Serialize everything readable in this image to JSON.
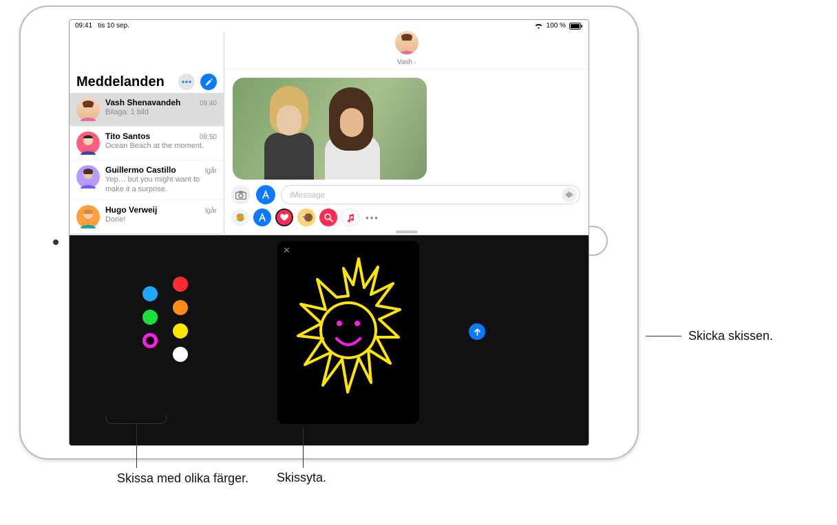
{
  "status": {
    "time": "09:41",
    "date": "tis 10 sep.",
    "battery_pct": "100 %"
  },
  "sidebar": {
    "title": "Meddelanden",
    "items": [
      {
        "name": "Vash Shenavandeh",
        "time": "09:40",
        "preview": "Bilaga: 1 bild"
      },
      {
        "name": "Tito Santos",
        "time": "08:50",
        "preview": "Ocean Beach at the moment."
      },
      {
        "name": "Guillermo Castillo",
        "time": "Igår",
        "preview": "Yep… but you might want to make it a surprise."
      },
      {
        "name": "Hugo Verweij",
        "time": "Igår",
        "preview": "Done!"
      }
    ]
  },
  "conversation": {
    "contact_name": "Vash",
    "input_placeholder": "iMessage"
  },
  "sketch": {
    "colors": [
      "blue",
      "red",
      "orange",
      "green",
      "yellow",
      "magenta",
      "white"
    ],
    "selected_color": "magenta"
  },
  "callouts": {
    "send": "Skicka skissen.",
    "colors": "Skissa med olika färger.",
    "canvas": "Skissyta."
  }
}
